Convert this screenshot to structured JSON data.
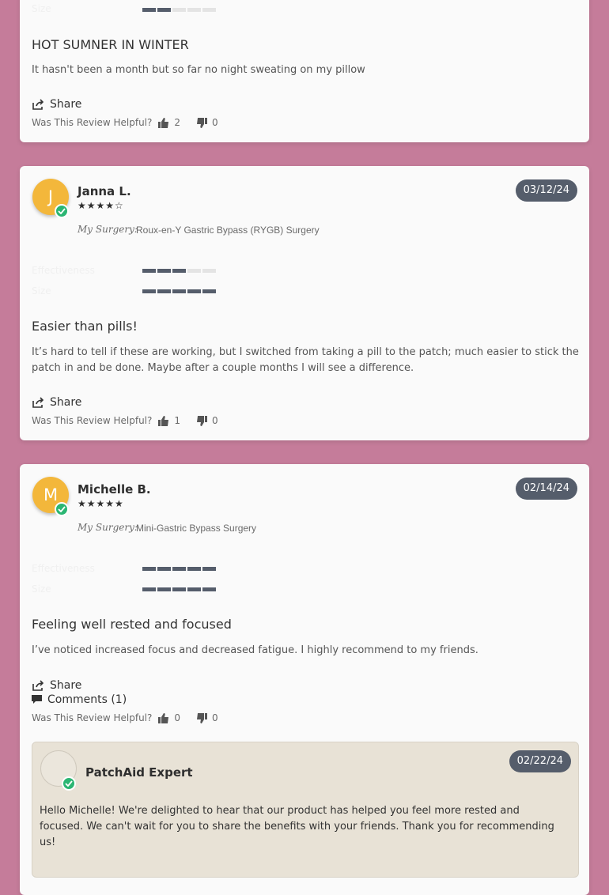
{
  "review0": {
    "title": "HOT SUMNER IN WINTER",
    "body": "It hasn't been a month but so far no night sweating on my pillow",
    "share_label": "Share",
    "helpful_label": "Was This Review Helpful?",
    "helpful_yes": "2",
    "helpful_no": "0",
    "attributes": [
      {
        "label": "Size",
        "rating": 2
      }
    ]
  },
  "review1": {
    "initial": "J",
    "name": "Janna L.",
    "stars": "★★★★☆",
    "rating": 4,
    "date": "03/12/24",
    "surgery_label": "My Surgery:",
    "surgery": "Roux-en-Y Gastric Bypass (RYGB) Surgery",
    "attributes": [
      {
        "label": "Effectiveness",
        "rating": 3
      },
      {
        "label": "Size",
        "rating": 5
      }
    ],
    "title": "Easier than pills!",
    "body": "It’s hard to tell if these are working, but I switched from taking a pill to the patch; much easier to stick the patch in and be done. Maybe after a couple months I will see a difference.",
    "share_label": "Share",
    "helpful_label": "Was This Review Helpful?",
    "helpful_yes": "1",
    "helpful_no": "0"
  },
  "review2": {
    "initial": "M",
    "name": "Michelle B.",
    "stars": "★★★★★",
    "rating": 5,
    "date": "02/14/24",
    "surgery_label": "My Surgery:",
    "surgery": "Mini-Gastric Bypass Surgery",
    "attributes": [
      {
        "label": "Effectiveness",
        "rating": 5
      },
      {
        "label": "Size",
        "rating": 5
      }
    ],
    "title": "Feeling well rested and focused",
    "body": "I’ve noticed increased focus and decreased fatigue. I highly recommend to my friends.",
    "share_label": "Share",
    "comments_label": "Comments (1)",
    "helpful_label": "Was This Review Helpful?",
    "helpful_yes": "0",
    "helpful_no": "0",
    "reply": {
      "author": "PatchAid Expert",
      "date": "02/22/24",
      "body": "Hello Michelle! We're delighted to hear that our product has helped you feel more rested and focused. We can't wait for you to share the benefits with your friends. Thank you for recommending us!"
    }
  },
  "colors": {
    "page_background": "#c57c9a",
    "badge": "#555d6b",
    "avatar": "#f3b73b",
    "verified": "#2bb673",
    "reply_background": "#e8e2d6"
  }
}
